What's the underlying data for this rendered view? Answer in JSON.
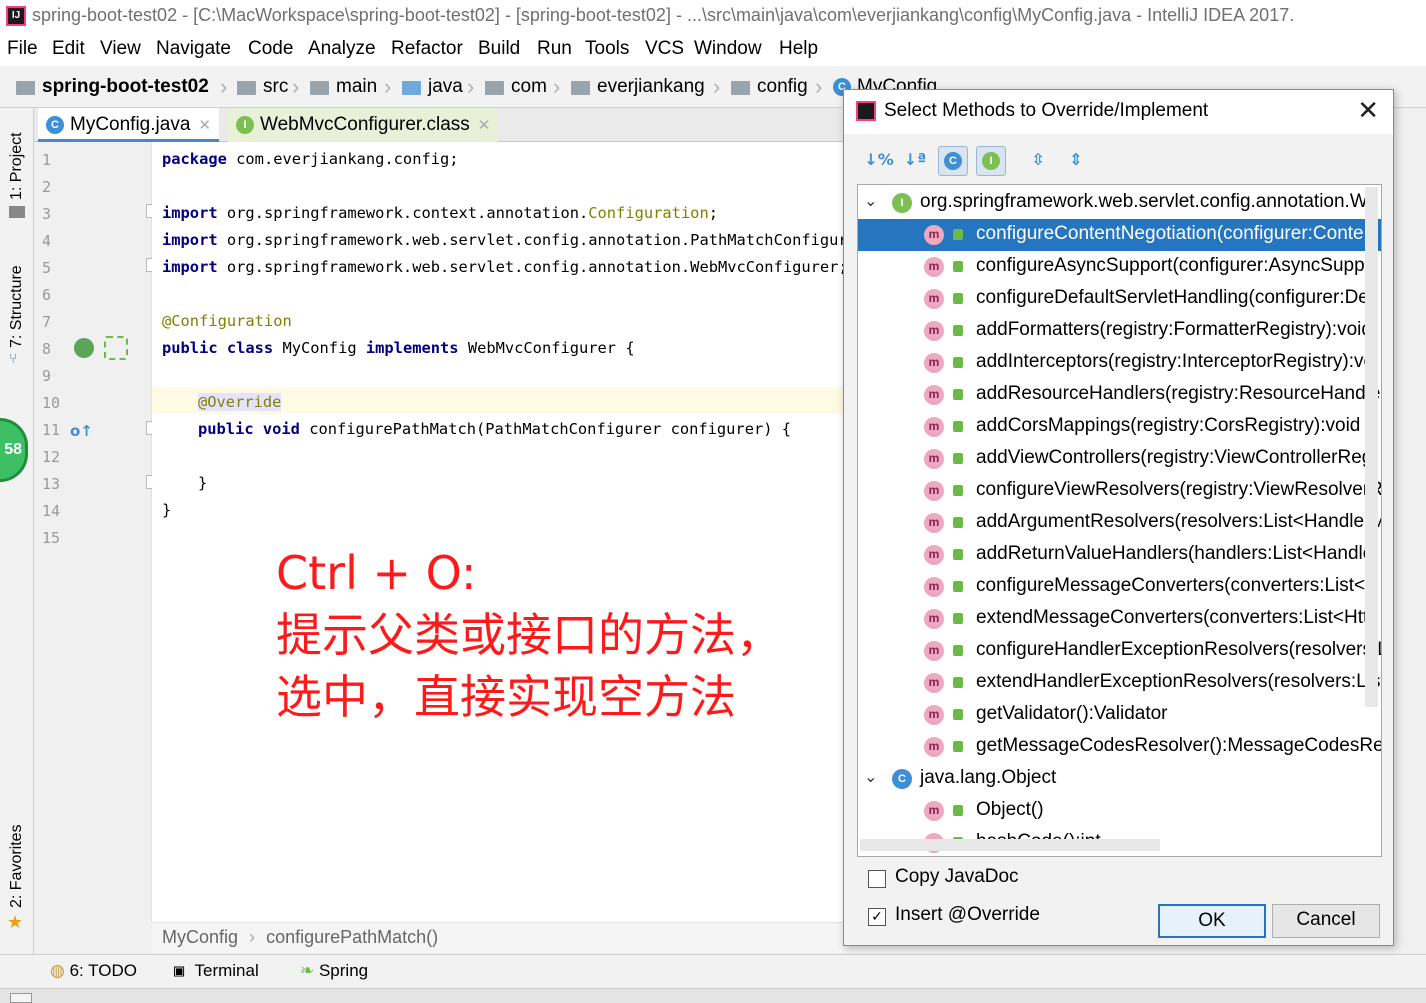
{
  "window": {
    "title": "spring-boot-test02 - [C:\\MacWorkspace\\spring-boot-test02] - [spring-boot-test02] - ...\\src\\main\\java\\com\\everjiankang\\config\\MyConfig.java - IntelliJ IDEA 2017."
  },
  "menu": [
    "File",
    "Edit",
    "View",
    "Navigate",
    "Code",
    "Analyze",
    "Refactor",
    "Build",
    "Run",
    "Tools",
    "VCS",
    "Window",
    "Help"
  ],
  "breadcrumb": [
    "spring-boot-test02",
    "src",
    "main",
    "java",
    "com",
    "everjiankang",
    "config",
    "MyConfig"
  ],
  "left_tabs": {
    "project": "1: Project",
    "structure": "7: Structure",
    "favorites": "2: Favorites"
  },
  "editor_tabs": [
    {
      "label": "MyConfig.java",
      "icon": "C"
    },
    {
      "label": "WebMvcConfigurer.class",
      "icon": "I"
    }
  ],
  "line_numbers": [
    "1",
    "2",
    "3",
    "4",
    "5",
    "6",
    "7",
    "8",
    "9",
    "10",
    "11",
    "12",
    "13",
    "14",
    "15"
  ],
  "code": {
    "l1_kw": "package",
    "l1_rest": " com.everjiankang.config;",
    "l3_kw": "import",
    "l3_rest": " org.springframework.context.annotation.",
    "l3_ann": "Configuration",
    "l3_end": ";",
    "l4_kw": "import",
    "l4_rest": " org.springframework.web.servlet.config.annotation.PathMatchConfigurer",
    "l5_kw": "import",
    "l5_rest": " org.springframework.web.servlet.config.annotation.WebMvcConfigurer;",
    "l7_ann": "@Configuration",
    "l8_kw1": "public class",
    "l8_name": " MyConfig ",
    "l8_kw2": "implements",
    "l8_rest": " WebMvcConfigurer {",
    "l10_ann": "@Override",
    "l11_kw": "public void",
    "l11_rest": " configurePathMatch(PathMatchConfigurer configurer) {",
    "l13": "}",
    "l14": "}"
  },
  "annotation_text": [
    "Ctrl + O:",
    "提示父类或接口的方法，",
    "选中，直接实现空方法"
  ],
  "editor_breadcrumb": {
    "class": "MyConfig",
    "method": "configurePathMatch()"
  },
  "bubble_count": "58",
  "bottom_tabs": {
    "todo": "6: TODO",
    "terminal": "Terminal",
    "spring": "Spring"
  },
  "dialog": {
    "title": "Select Methods to Override/Implement",
    "groups": [
      {
        "name": "org.springframework.web.servlet.config.annotation.W",
        "icon": "I"
      },
      {
        "name": "java.lang.Object",
        "icon": "C"
      }
    ],
    "methods_group1": [
      "configureContentNegotiation(configurer:Conte",
      "configureAsyncSupport(configurer:AsyncSuppo",
      "configureDefaultServletHandling(configurer:De",
      "addFormatters(registry:FormatterRegistry):void",
      "addInterceptors(registry:InterceptorRegistry):vo",
      "addResourceHandlers(registry:ResourceHandlerRegi",
      "addCorsMappings(registry:CorsRegistry):void",
      "addViewControllers(registry:ViewControllerReg",
      "configureViewResolvers(registry:ViewResolverR",
      "addArgumentResolvers(resolvers:List<HandlerM",
      "addReturnValueHandlers(handlers:List<Handle",
      "configureMessageConverters(converters:List<H",
      "extendMessageConverters(converters:List<Http",
      "configureHandlerExceptionResolvers(resolvers:L",
      "extendHandlerExceptionResolvers(resolvers:List",
      "getValidator():Validator",
      "getMessageCodesResolver():MessageCodesRes"
    ],
    "methods_group2": [
      "Object()",
      "hashCode():int"
    ],
    "copy_javadoc": {
      "label": "Copy JavaDoc",
      "checked": false
    },
    "insert_override": {
      "label": "Insert @Override",
      "checked": true
    },
    "ok": "OK",
    "cancel": "Cancel"
  },
  "colors": {
    "selection": "#2675bf",
    "annotation": "#ff1a1a",
    "keyword": "#000080"
  }
}
